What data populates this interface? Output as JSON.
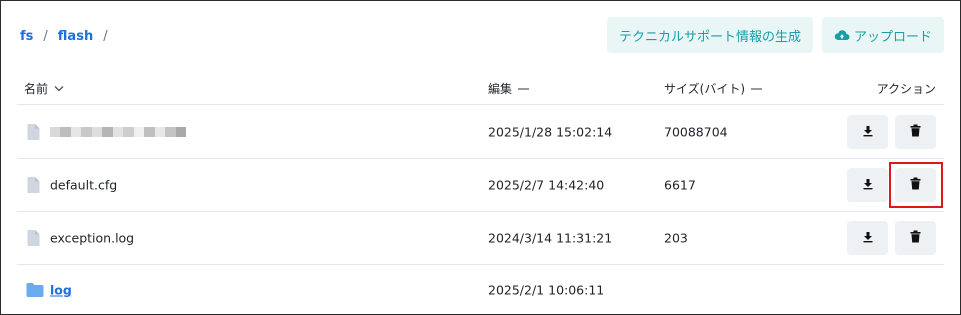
{
  "breadcrumb": {
    "root": "fs",
    "separator": "/",
    "folder": "flash",
    "trailing": "/"
  },
  "toolbar": {
    "support_label": "テクニカルサポート情報の生成",
    "upload_label": "アップロード",
    "upload_icon": "cloud-upload-icon"
  },
  "table": {
    "headers": {
      "name": "名前",
      "edit": "編集",
      "size": "サイズ(バイト)",
      "action": "アクション"
    },
    "rows": [
      {
        "name": "",
        "edited": "2025/1/28 15:02:14",
        "size": "70088704",
        "type": "file",
        "redacted": true
      },
      {
        "name": "default.cfg",
        "edited": "2025/2/7 14:42:40",
        "size": "6617",
        "type": "file"
      },
      {
        "name": "exception.log",
        "edited": "2024/3/14 11:31:21",
        "size": "203",
        "type": "file"
      },
      {
        "name": "log",
        "edited": "2025/2/1 10:06:11",
        "size": "",
        "type": "folder"
      }
    ]
  },
  "colors": {
    "accent": "#16a0a8",
    "link": "#1e6fd9",
    "highlight": "#e0171a",
    "button_bg": "#eef1f4"
  }
}
